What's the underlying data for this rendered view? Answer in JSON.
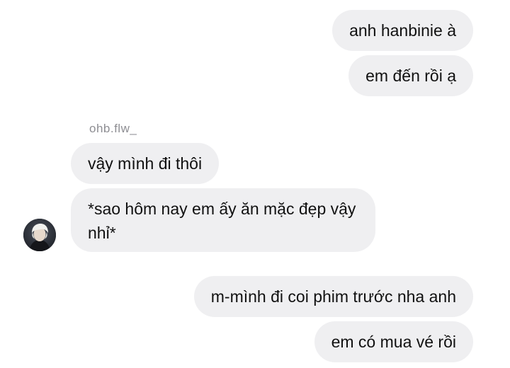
{
  "conversation": {
    "sender_name": "ohb.flw_",
    "messages": [
      {
        "side": "right",
        "text": "anh hanbinie à"
      },
      {
        "side": "right",
        "text": "em đến rồi ạ"
      },
      {
        "side": "left",
        "text": "vậy mình đi thôi"
      },
      {
        "side": "left",
        "text": "*sao hôm nay em ấy ăn mặc đẹp vậy nhỉ*"
      },
      {
        "side": "right",
        "text": "m-mình đi coi phim trước nha anh"
      },
      {
        "side": "right",
        "text": "em có mua vé rồi"
      }
    ]
  },
  "colors": {
    "bubble_bg": "#efeff1",
    "text": "#111111",
    "sender_name": "#8e8e93",
    "background": "#ffffff"
  },
  "icons": {
    "avatar": "profile-avatar-icon"
  }
}
